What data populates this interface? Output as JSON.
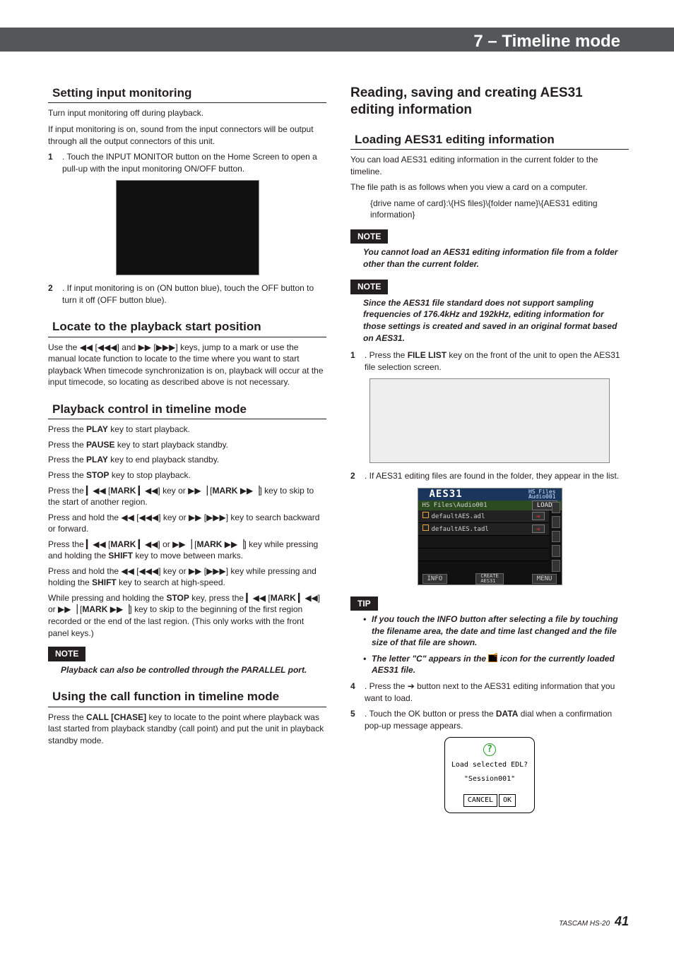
{
  "banner": {
    "title": "7 – Timeline mode"
  },
  "left": {
    "s1": {
      "heading": "Setting input monitoring",
      "p1": "Turn input monitoring off during playback.",
      "p2": "If input monitoring is on, sound from the input connectors will be output through all the output connectors of this unit.",
      "li1a": ".  Touch the INPUT MONITOR button on the Home Screen to open a pull-up with the input monitoring ON/OFF button.",
      "li2a": ".  If input monitoring is on (ON button blue), touch the OFF button to turn it off (OFF button blue)."
    },
    "s2": {
      "heading": "Locate to the playback start position",
      "p1a": "Use the ",
      "p1b": " keys, jump to a mark or use the manual locate function to locate to the time where you want to start playback When timecode synchronization is on, playback will occur at the input timecode, so locating as described above is not necessary."
    },
    "s3": {
      "heading": "Playback control in timeline mode",
      "p1a": "Press the ",
      "p1b": "PLAY",
      "p1c": " key to start playback.",
      "p2a": "Press the ",
      "p2b": "PAUSE",
      "p2c": " key to start playback standby.",
      "p3a": "Press the ",
      "p3b": "PLAY",
      "p3c": " key to end playback standby.",
      "p4a": "Press the ",
      "p4b": "STOP",
      "p4c": " key to stop playback.",
      "p5": "] key to skip to the start of another region.",
      "p6": "] key to search backward or forward.",
      "p7b": " key to move between marks.",
      "p8b": " key to search at high-speed.",
      "p9a": "While pressing and holding the ",
      "p9b": "STOP",
      "p9c": "] key to skip to the beginning of the first region recorded or the end of the last region. (This only works with the front panel keys.)",
      "note": "Playback can also be controlled through the PARALLEL port."
    },
    "s4": {
      "heading": "Using the call function in timeline mode",
      "p1a": "Press the ",
      "p1b": "CALL [CHASE]",
      "p1c": " key to locate to the point where playback was last started from playback standby (call point) and put the unit in playback standby mode."
    }
  },
  "right": {
    "major": "Reading, saving and creating AES31 editing information",
    "s1": {
      "heading": "Loading AES31 editing information",
      "p1": "You can load AES31 editing information in the current folder to the timeline.",
      "p2": "The file path is as follows when you view a card on a computer.",
      "path": "{drive name of card}:\\{HS files}\\{folder name}\\{AES31 editing information}",
      "note1": "You cannot load an AES31 editing information file from a folder other than the current folder.",
      "note2": "Since the AES31 file standard does not support sampling frequencies of 176.4kHz and 192kHz, editing information for those settings is created and saved in an original format based on AES31.",
      "li1a": ".  Press the ",
      "li1b": "FILE LIST",
      "li1c": " key on the front of the unit to open the AES31 file selection screen.",
      "li2": ". If AES31 editing files are found in the folder, they appear in the list.",
      "aes": {
        "title": "AES31",
        "sub1": "HS Files",
        "sub2": "Audio001",
        "crumb": "HS Files\\Audio001",
        "load": "LOAD",
        "row1": "defaultAES.adl",
        "row2": "defaultAES.tadl",
        "info": "INFO",
        "create": "CREATE\nAES31",
        "menu": "MENU"
      },
      "tip1": "If you touch the INFO button after selecting a file by touching the filename area, the date and time last changed and the file size of that file are shown.",
      "tip2a": "The letter \"C\" appears in the ",
      "tip2b": " icon for the currently loaded AES31 file.",
      "li4": ".  Press the ➔ button next to the AES31 editing information that you want to load.",
      "li5a": ".  Touch the OK button or press the ",
      "li5b": "DATA",
      "li5c": " dial when a confirmation pop-up message appears.",
      "popup": {
        "line1": "Load selected EDL?",
        "line2": "\"Session001\"",
        "cancel": "CANCEL",
        "ok": "OK"
      }
    }
  },
  "glyphs": {
    "rew": "◀◀",
    "rew3": "◀◀◀",
    "ff": "▶▶",
    "ff3": "▶▶▶",
    "mprev": "▎◀◀",
    "mnext": "▶▶▕",
    "mark": "MARK",
    "shift": "SHIFT",
    "arrow": "➔"
  },
  "footer": {
    "label": "TASCAM HS-20",
    "page": "41"
  },
  "labels": {
    "note": "NOTE",
    "tip": "TIP",
    "n1": "1",
    "n2": "2",
    "n4": "4",
    "n5": "5"
  }
}
